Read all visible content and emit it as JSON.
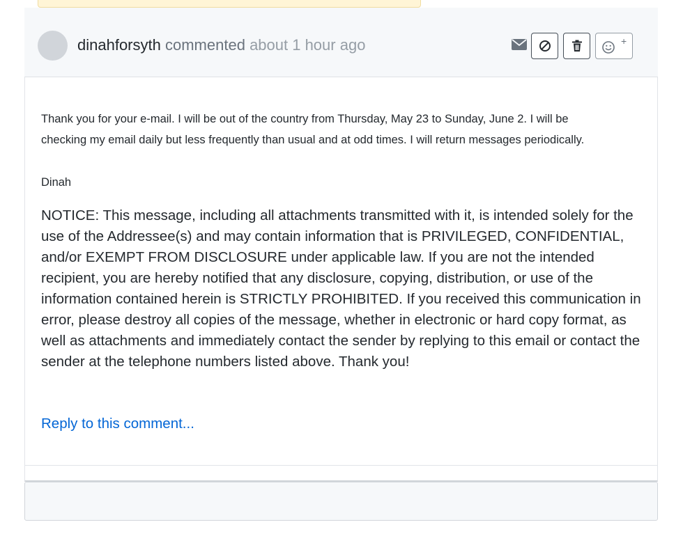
{
  "comment": {
    "author": "dinahforsyth",
    "action": "commented",
    "timestamp": "about 1 hour ago",
    "icons": {
      "email": "envelope-icon",
      "block": "block-icon",
      "delete": "trash-icon",
      "reaction": "smiley-icon"
    },
    "reaction_plus": "+",
    "body": {
      "paragraph_line1": "Thank you for your e-mail. I will be out of the country from Thursday, May 23 to Sunday, June 2.  I will be",
      "paragraph_line2": "checking my email daily but less frequently than usual and at odd times. I will return messages periodically.",
      "signature": "Dinah",
      "notice": "NOTICE: This message, including all attachments transmitted with it, is intended solely for the use of the Addressee(s) and may contain information that is PRIVILEGED, CONFIDENTIAL, and/or EXEMPT FROM DISCLOSURE under applicable law. If you are not the intended recipient, you are hereby notified that any disclosure, copying, distribution, or use of the information contained herein is STRICTLY PROHIBITED. If you received this communication in error, please destroy all copies of the message, whether in electronic or hard copy format, as well as attachments and immediately contact the sender by replying to this email or contact the sender at the telephone numbers listed above. Thank you!"
    },
    "reply_link": "Reply to this comment..."
  },
  "colors": {
    "link": "#0366d6",
    "header_bg": "#f6f8fa",
    "text": "#24292e",
    "muted": "#6a737d",
    "banner": "#fff5d6"
  }
}
